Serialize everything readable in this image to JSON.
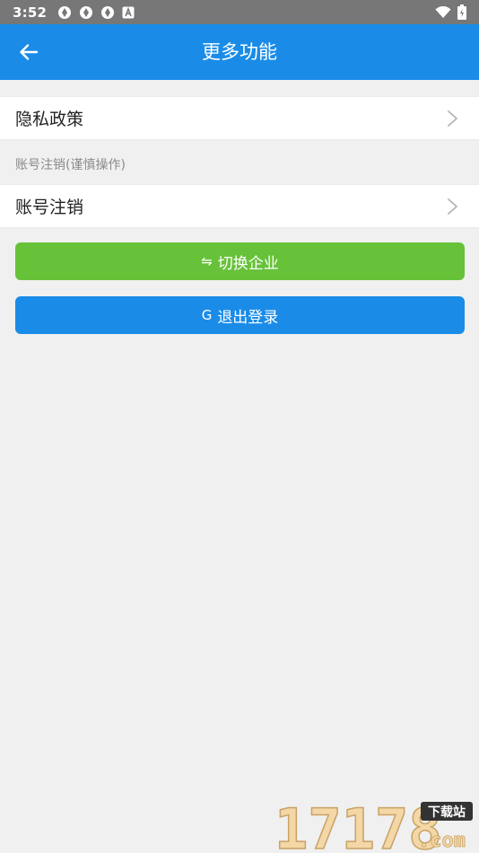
{
  "status_bar": {
    "time": "3:52",
    "notification_icons": [
      "aperture-icon",
      "aperture-icon",
      "aperture-icon",
      "a-badge-icon"
    ],
    "wifi_icon": "wifi-icon",
    "battery_icon": "battery-icon"
  },
  "app_bar": {
    "title": "更多功能",
    "back_icon": "arrow-left-icon"
  },
  "menu": {
    "privacy_policy": "隐私政策",
    "section_header": "账号注销(谨慎操作)",
    "account_cancel": "账号注销"
  },
  "buttons": {
    "switch_company": {
      "icon_glyph": "⇋",
      "label": "切换企业"
    },
    "logout": {
      "icon_glyph": "G",
      "label": "退出登录"
    }
  },
  "watermark": {
    "text": "17178",
    "badge": "下载站",
    "suffix": ".com"
  },
  "colors": {
    "app_bar": "#1a8ce8",
    "status_bar": "#777777",
    "switch_button": "#67c23a",
    "logout_button": "#1a8ce8",
    "background": "#f0f0f0"
  }
}
